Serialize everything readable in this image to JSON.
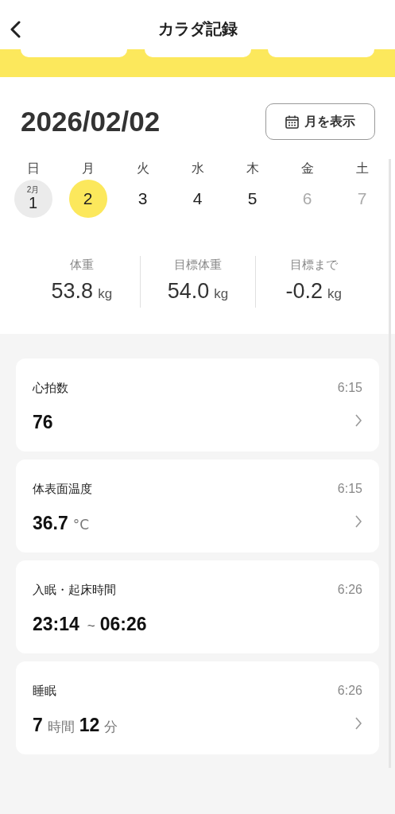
{
  "header": {
    "title": "カラダ記録"
  },
  "date": "2026/02/02",
  "month_button": {
    "label": "月を表示"
  },
  "days": [
    {
      "weekday": "日",
      "month": "2月",
      "day": "1",
      "selected": false,
      "shaded": true,
      "disabled": false
    },
    {
      "weekday": "月",
      "day": "2",
      "selected": true,
      "shaded": false,
      "disabled": false
    },
    {
      "weekday": "火",
      "day": "3",
      "selected": false,
      "shaded": false,
      "disabled": false
    },
    {
      "weekday": "水",
      "day": "4",
      "selected": false,
      "shaded": false,
      "disabled": false
    },
    {
      "weekday": "木",
      "day": "5",
      "selected": false,
      "shaded": false,
      "disabled": false
    },
    {
      "weekday": "金",
      "day": "6",
      "selected": false,
      "shaded": false,
      "disabled": true
    },
    {
      "weekday": "土",
      "day": "7",
      "selected": false,
      "shaded": false,
      "disabled": true
    }
  ],
  "stats": [
    {
      "label": "体重",
      "value": "53.8",
      "unit": "kg"
    },
    {
      "label": "目標体重",
      "value": "54.0",
      "unit": "kg"
    },
    {
      "label": "目標まで",
      "value": "-0.2",
      "unit": "kg"
    }
  ],
  "records": [
    {
      "title": "心拍数",
      "time": "6:15",
      "chevron": true,
      "parts": [
        {
          "kind": "num",
          "text": "76"
        }
      ]
    },
    {
      "title": "体表面温度",
      "time": "6:15",
      "chevron": true,
      "parts": [
        {
          "kind": "num",
          "text": "36.7"
        },
        {
          "kind": "unit",
          "text": "°C"
        }
      ]
    },
    {
      "title": "入眠・起床時間",
      "time": "6:26",
      "chevron": false,
      "parts": [
        {
          "kind": "num",
          "text": "23:14"
        },
        {
          "kind": "sep",
          "text": "~"
        },
        {
          "kind": "num",
          "text": "06:26"
        }
      ]
    },
    {
      "title": "睡眠",
      "time": "6:26",
      "chevron": true,
      "parts": [
        {
          "kind": "num",
          "text": "7"
        },
        {
          "kind": "unit",
          "text": "時間"
        },
        {
          "kind": "num",
          "text": "12"
        },
        {
          "kind": "unit",
          "text": "分"
        }
      ]
    }
  ]
}
